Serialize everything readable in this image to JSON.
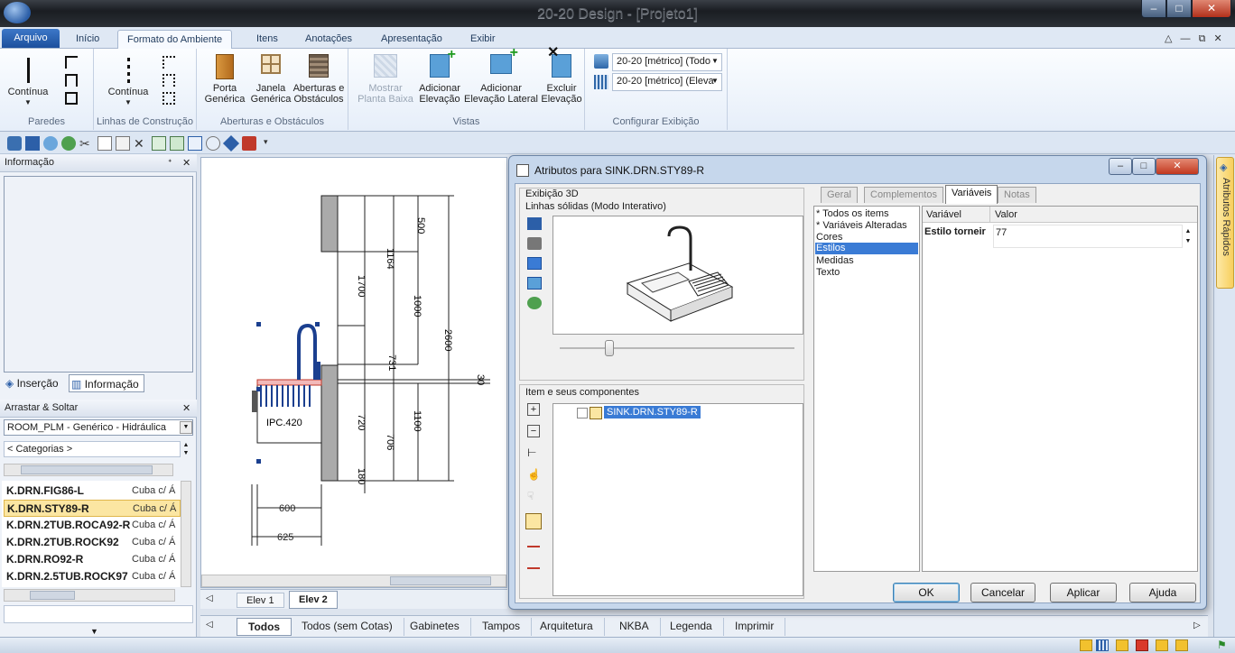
{
  "window": {
    "title": "20-20 Design - [Projeto1]",
    "min": "–",
    "max": "□",
    "close": "✕"
  },
  "ribbon": {
    "tabs": [
      "Arquivo",
      "Início",
      "Formato do Ambiente",
      "Itens",
      "Anotações",
      "Apresentação",
      "Exibir"
    ],
    "window_controls": "△ — ⧉ ✕",
    "groups": {
      "paredes": {
        "label": "Paredes",
        "btn1": "Contínua"
      },
      "construcao": {
        "label": "Linhas de Construção",
        "btn1": "Contínua"
      },
      "aberturas": {
        "label": "Aberturas e Obstáculos",
        "porta": "Porta Genérica",
        "janela": "Janela Genérica",
        "aberturas": "Aberturas e Obstáculos"
      },
      "vistas": {
        "label": "Vistas",
        "mostrar": "Mostrar Planta Baixa",
        "adicionar": "Adicionar Elevação",
        "lateral": "Adicionar Elevação Lateral",
        "excluir": "Excluir Elevação"
      },
      "exibicao": {
        "label": "Configurar Exibição",
        "combo1": "20-20 [métrico] (Todo",
        "combo2": "20-20 [métrico] (Eleva"
      }
    }
  },
  "left": {
    "info_header": "Informação",
    "info_tabs": {
      "insercao": "Inserção",
      "informacao": "Informação"
    },
    "drag_header": "Arrastar & Soltar",
    "catalog": "ROOM_PLM - Genérico - Hidráulica",
    "categories": "< Categorias >",
    "items": [
      {
        "code": "K.DRN.FIG86-L",
        "desc": "Cuba c/ Á"
      },
      {
        "code": "K.DRN.STY89-R",
        "desc": "Cuba c/ Á"
      },
      {
        "code": "K.DRN.2TUB.ROCA92-R",
        "desc": "Cuba c/ Á"
      },
      {
        "code": "K.DRN.2TUB.ROCK92",
        "desc": "Cuba c/ Á"
      },
      {
        "code": "K.DRN.RO92-R",
        "desc": "Cuba c/ Á"
      },
      {
        "code": "K.DRN.2.5TUB.ROCK97",
        "desc": "Cuba c/ Á"
      }
    ]
  },
  "drawing": {
    "dims": {
      "d500": "500",
      "d1164": "1164",
      "d1700": "1700",
      "d1000": "1000",
      "d2600": "2600",
      "d731": "731",
      "d30": "30",
      "d720": "720",
      "d706": "706",
      "d1100": "1100",
      "d180": "180",
      "d600": "600",
      "d625": "625"
    },
    "label": "IPC.420",
    "tabs": [
      "Elev 1",
      "Elev 2"
    ]
  },
  "bottom_tabs": [
    "Todos",
    "Todos (sem Cotas)",
    "Gabinetes",
    "Tampos",
    "Arquitetura",
    "NKBA",
    "Legenda",
    "Imprimir"
  ],
  "dialog": {
    "title": "Atributos para SINK.DRN.STY89-R",
    "view_header": "Exibição 3D",
    "view_mode": "Linhas sólidas (Modo Interativo)",
    "components_header": "Item e seus componentes",
    "component_item": "SINK.DRN.STY89-R",
    "tabs": [
      "Geral",
      "Complementos",
      "Variáveis",
      "Notas"
    ],
    "filters": [
      "* Todos os items",
      "* Variáveis Alteradas",
      "Cores",
      "Estilos",
      "Medidas",
      "Texto"
    ],
    "grid": {
      "col_var": "Variável",
      "col_val": "Valor",
      "row_var": "Estilo torneir",
      "row_val": "77"
    },
    "buttons": {
      "ok": "OK",
      "cancelar": "Cancelar",
      "aplicar": "Aplicar",
      "ajuda": "Ajuda"
    }
  },
  "right_panel": {
    "label": "Atributos Rápidos"
  }
}
